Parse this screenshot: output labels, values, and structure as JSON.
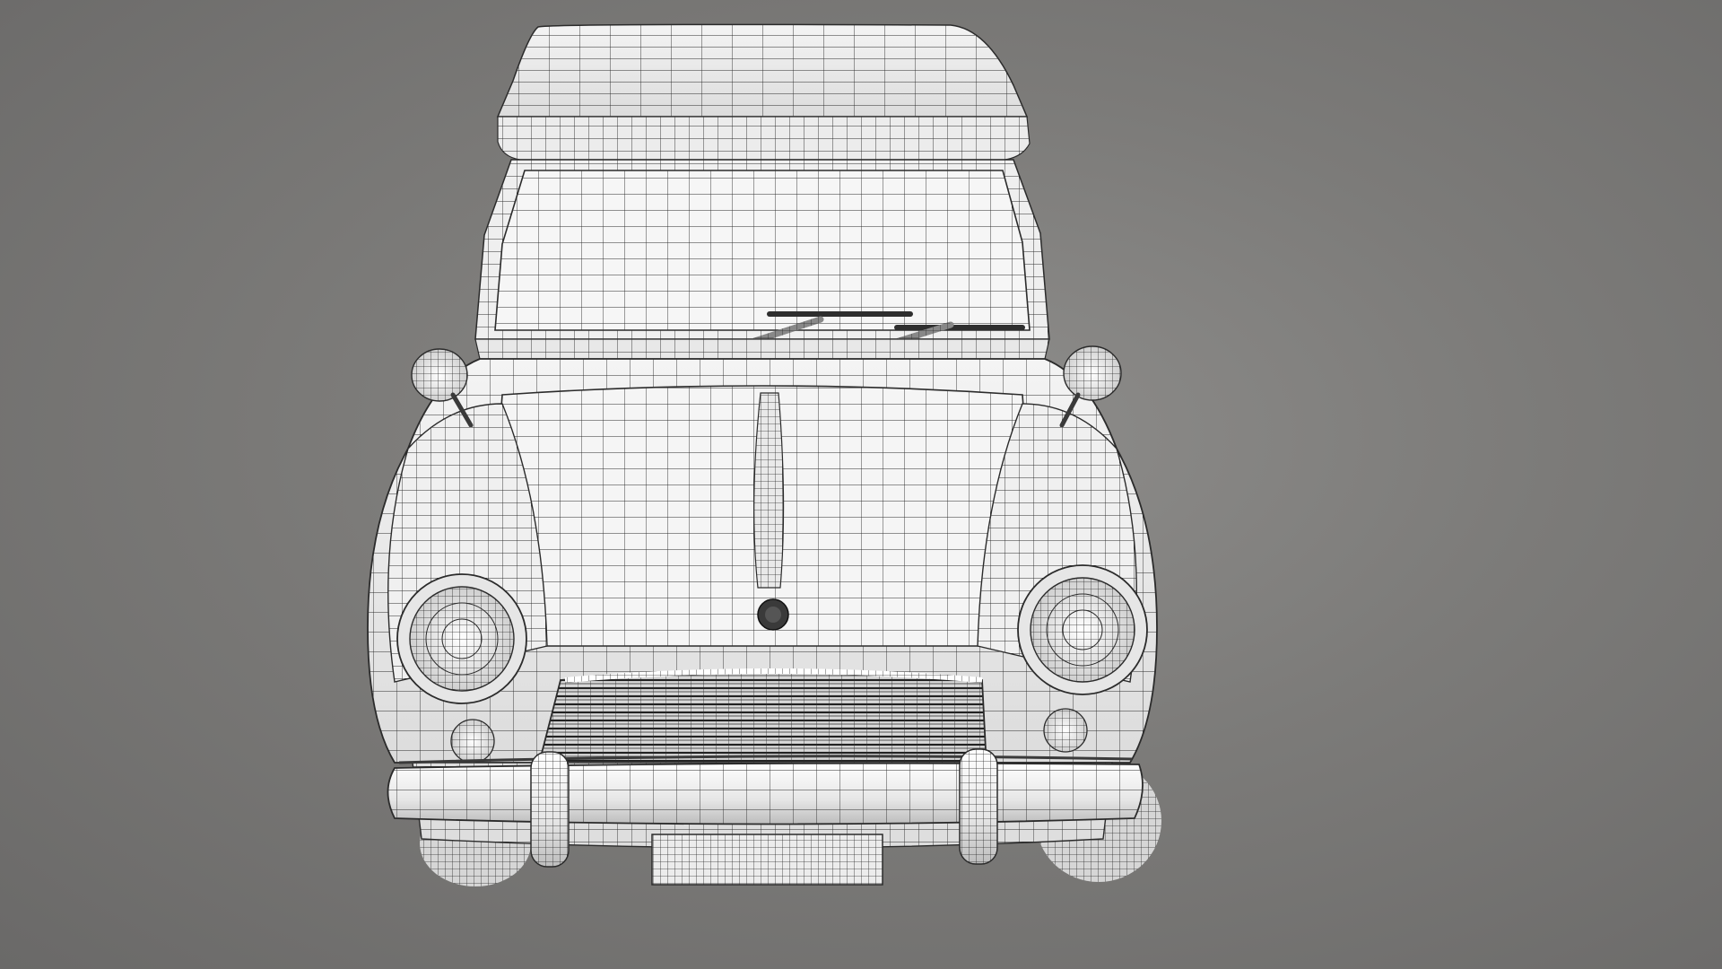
{
  "scene": {
    "background_color": "#7c7b79",
    "model_fill": "#f2f2f2",
    "model_shade": "#d9d9d9",
    "wire_color": "#2b2b2b",
    "dark_part_color": "#3a3a3a",
    "object": "car-wireframe-model"
  }
}
